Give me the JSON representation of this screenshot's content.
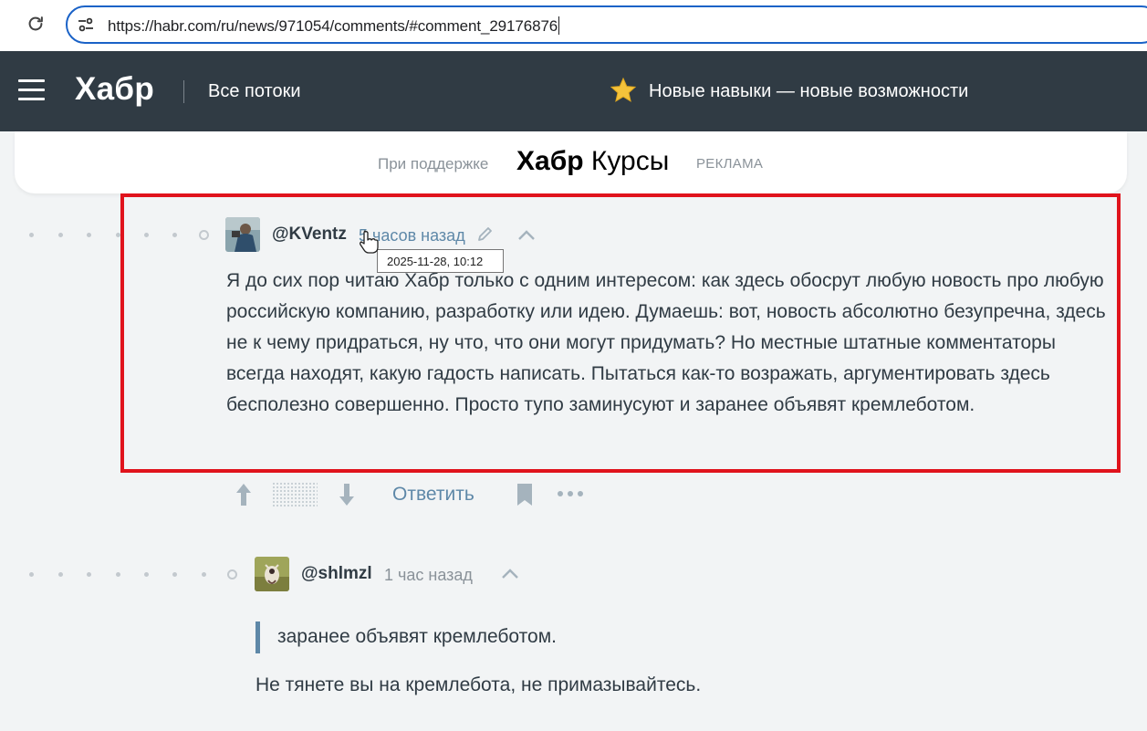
{
  "browser": {
    "url": "https://habr.com/ru/news/971054/comments/#comment_29176876",
    "icons": {
      "reload": "reload-icon",
      "site_info": "site-info-icon"
    }
  },
  "header": {
    "logo": "Хабр",
    "nav_label": "Все потоки",
    "promo_text": "Новые навыки — новые возможности",
    "icons": {
      "menu": "hamburger-menu-icon",
      "promo": "star-icon"
    },
    "background": "#303b44"
  },
  "sponsor": {
    "label": "При поддержке",
    "brand_bold": "Хабр",
    "brand_rest": "Курсы",
    "ad_label": "РЕКЛАМА"
  },
  "comments": [
    {
      "author": "@KVentz",
      "time": "5 часов назад",
      "tooltip": "2025-11-28, 10:12",
      "text": "Я до сих пор читаю Хабр только с одним интересом: как здесь обосрут любую новость про любую российскую компанию, разработку или идею. Думаешь: вот, новость абсолютно безупречна, здесь не к чему придраться, ну что, что они могут придумать? Но местные штатные комментаторы всегда находят, какую гадость написать. Пытаться как-то возражать, аргументировать здесь бесполезно совершенно. Просто тупо заминусуют и заранее объявят кремлеботом.",
      "highlighted": true,
      "highlight_color": "#e0131c",
      "actions": {
        "reply_label": "Ответить",
        "icons": [
          "upvote-icon",
          "downvote-icon",
          "bookmark-icon",
          "more-icon"
        ]
      }
    },
    {
      "author": "@shlmzl",
      "time": "1 час назад",
      "quote": "заранее объявят кремлеботом.",
      "text": "Не тянете вы на кремлебота, не примазывайтесь."
    }
  ],
  "colors": {
    "accent": "#5e88a8",
    "text": "#303b44",
    "muted": "#8a9299"
  }
}
